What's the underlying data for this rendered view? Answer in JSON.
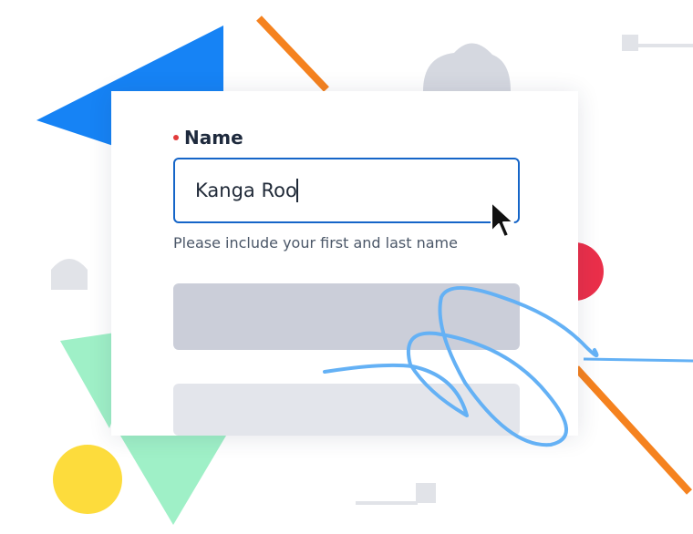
{
  "form": {
    "name_label": "Name",
    "name_value": "Kanga Roo",
    "name_help": "Please include your first and last name"
  },
  "colors": {
    "accent": "#1565c8",
    "required": "#e23b3b",
    "blue_shape": "#1683f5",
    "orange": "#f5821f",
    "green": "#9ff0c7",
    "yellow": "#fddc3c",
    "red": "#ea2f4a",
    "gray": "#d5d8e0",
    "scribble": "#64b1f5"
  },
  "icons": [
    "mouse-pointer-icon"
  ]
}
